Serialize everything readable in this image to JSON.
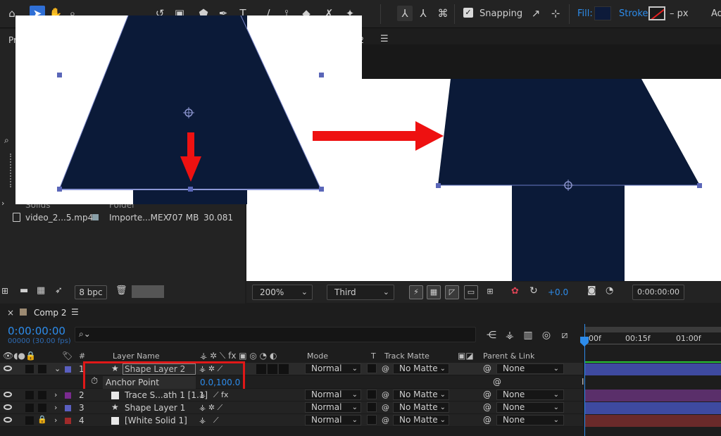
{
  "toolbar": {
    "snapping_label": "Snapping",
    "fill_label": "Fill:",
    "stroke_label": "Stroke:",
    "stroke_width": "– px",
    "truncated_right": "Ad",
    "fill_color": "#0d1b3a",
    "stroke_color": "#e32020"
  },
  "project": {
    "tab_label": "Pr",
    "solids_name": "Solids",
    "solids_type": "Folder",
    "item_name": "video_2...5.mp4",
    "item_type": "Importe...MEX",
    "item_size": "707 MB",
    "item_rate": "30.081",
    "bpc_label": "8 bpc"
  },
  "composition": {
    "tab_label": "p 2",
    "zoom": "200%",
    "resolution": "Third",
    "exposure": "+0.0",
    "timecode": "0:00:00:00",
    "shape_color": "#0b1a38"
  },
  "timeline": {
    "tab_name": "Comp 2",
    "current_time": "0:00:00:00",
    "frame_info": "00000 (30.00 fps)",
    "search_placeholder": "",
    "columns": {
      "hash": "#",
      "layer_name": "Layer Name",
      "mode": "Mode",
      "t": "T",
      "track_matte": "Track Matte",
      "parent_link": "Parent & Link"
    },
    "ruler": [
      "00f",
      "00:15f",
      "01:00f"
    ],
    "layers": [
      {
        "num": "1",
        "name": "Shape Layer 2",
        "label_color": "#5a5fc0",
        "mode": "Normal",
        "matte": "No Matte",
        "parent": "None",
        "track_color": "#3e4aa0"
      },
      {
        "num": "2",
        "name": "Trace S...ath 1 [1.1]",
        "label_color": "#7a2b8f",
        "mode": "Normal",
        "matte": "No Matte",
        "parent": "None",
        "track_color": "#5a2f6a"
      },
      {
        "num": "3",
        "name": "Shape Layer 1",
        "label_color": "#5a5fc0",
        "mode": "Normal",
        "matte": "No Matte",
        "parent": "None",
        "track_color": "#3e4aa0"
      },
      {
        "num": "4",
        "name": "[White Solid 1]",
        "label_color": "#a02a2a",
        "mode": "Normal",
        "matte": "No Matte",
        "parent": "None",
        "track_color": "#6a2a2a"
      }
    ],
    "anchor_point": {
      "label": "Anchor Point",
      "value": "0.0,100.0"
    }
  }
}
